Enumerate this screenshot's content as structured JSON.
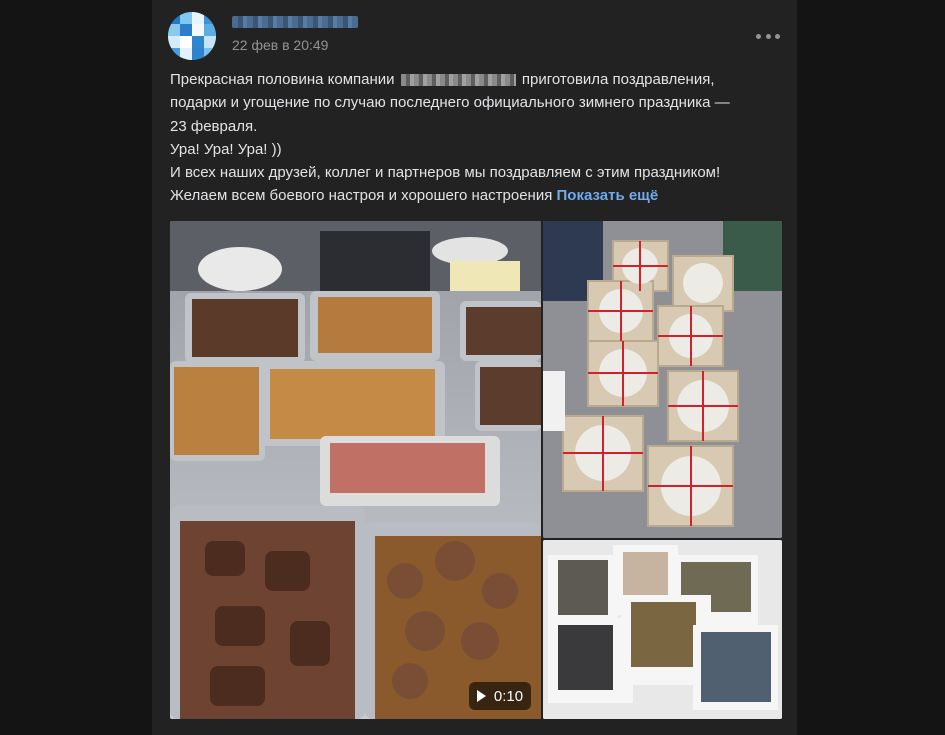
{
  "post": {
    "date": "22 фев в 20:49",
    "text_line1_before": "Прекрасная половина компании",
    "text_line1_after": "приготовила поздравления,",
    "text_line2": "подарки и угощение по случаю последнего официального зимнего праздника —",
    "text_line3": "23 февраля.",
    "text_line4": "Ура! Ура! Ура! ))",
    "text_line5": "И всех наших друзей, коллег и партнеров мы поздравляем с этим праздником!",
    "text_line6": "Желаем всем боевого настроя и хорошего настроения",
    "show_more": "Показать ещё"
  },
  "media": {
    "video_duration": "0:10"
  },
  "icons": {
    "more": "more-horizontal-icon",
    "play": "play-icon"
  },
  "colors": {
    "background": "#141414",
    "card": "#222222",
    "text": "#e1e3e6",
    "secondary": "#939393",
    "link": "#71aaeb"
  }
}
